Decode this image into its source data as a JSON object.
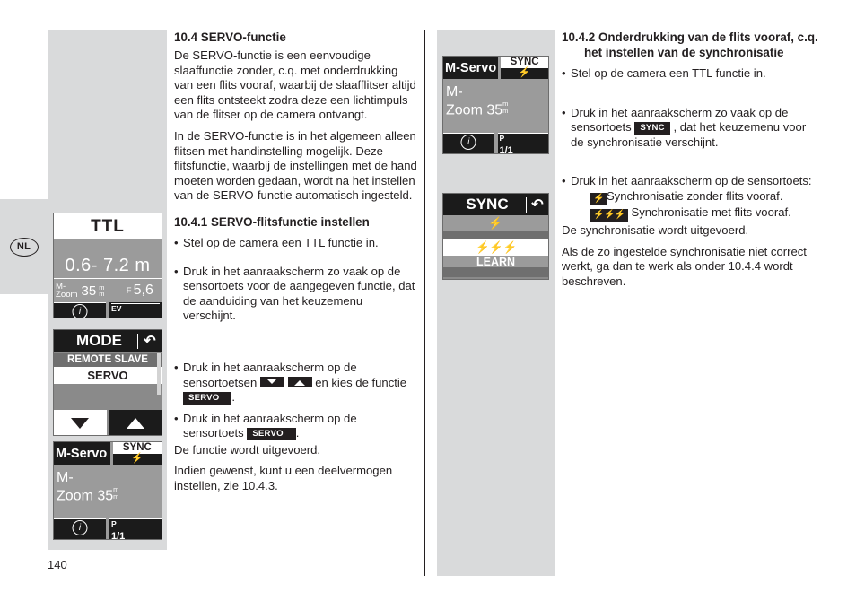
{
  "page": {
    "number": "140",
    "language_badge": "NL"
  },
  "column_left_figures": {
    "ttl_display": {
      "title": "TTL",
      "range": "0.6- 7.2 m",
      "zoom_label_line1": "M-",
      "zoom_label_line2": "Zoom",
      "zoom_value": "35",
      "zoom_unit_top": "m",
      "zoom_unit_bottom": "m",
      "aperture_prefix": "F",
      "aperture_value": "5,6",
      "info_symbol": "i",
      "ev_label": "EV"
    },
    "mode_display": {
      "title": "MODE",
      "back_icon": "↶",
      "item_1": "REMOTE SLAVE",
      "item_2_selected": "SERVO",
      "button_down": "down-arrow",
      "button_up": "up-arrow"
    },
    "mservo_display": {
      "left_label": "M-Servo",
      "sync_label": "SYNC",
      "sync_bolt": "⚡",
      "body_line1": "M-",
      "body_line2_prefix": "Zoom",
      "body_zoom_value": "35",
      "body_unit_top": "m",
      "body_unit_bottom": "m",
      "info_symbol": "i",
      "p_label": "P",
      "p_value": "1/1"
    }
  },
  "column_mid_figures": {
    "mservo_display": {
      "left_label": "M-Servo",
      "sync_label": "SYNC",
      "sync_bolt": "⚡",
      "body_line1": "M-",
      "body_line2_prefix": "Zoom",
      "body_zoom_value": "35",
      "body_unit_top": "m",
      "body_unit_bottom": "m",
      "info_symbol": "i",
      "p_label": "P",
      "p_value": "1/1"
    },
    "sync_menu_display": {
      "title": "SYNC",
      "back_icon": "↶",
      "option_1": "⚡",
      "option_2": "⚡⚡⚡",
      "option_3": "LEARN"
    }
  },
  "column_2": {
    "heading_main": "10.4 SERVO-functie",
    "para_1": "De SERVO-functie is een eenvoudige slaaffunctie zonder, c.q. met onderdrukking van een flits vooraf,  waarbij de slaafflitser altijd een flits ontsteekt zodra deze een lichtimpuls van de flitser op de camera ontvangt.",
    "para_2": "In de SERVO-functie is in het algemeen alleen flitsen met handinstelling mogelijk. Deze flitsfunctie,  waarbij de instellingen met de hand moeten worden gedaan, wordt na het instellen van de SERVO-functie automatisch ingesteld.",
    "heading_sub": "10.4.1 SERVO-flitsfunctie instellen",
    "bullet_1": "Stel op de camera een TTL functie in.",
    "bullet_2": "Druk in het aanraakscherm zo vaak op de sensortoets voor de aangegeven functie, dat de aanduiding van het keuzemenu verschijnt.",
    "bullet_3_pre": "Druk in het aanraakscherm op de sensortoetsen",
    "bullet_3_mid": "en kies de functie",
    "bullet_3_badge": "SERVO",
    "bullet_3_post": ".",
    "bullet_4_pre": "Druk in het aanraakscherm op de sensortoets",
    "bullet_4_badge": "SERVO",
    "bullet_4_post": ".",
    "para_3": "De functie wordt uitgevoerd.",
    "para_4": "Indien gewenst, kunt u een deelvermogen instellen, zie 10.4.3."
  },
  "column_3": {
    "heading_line1": "10.4.2 Onderdrukking van de flits vooraf, c.q.",
    "heading_line2": "het instellen van de synchronisatie",
    "bullet_1": "Stel op de camera een TTL functie in.",
    "bullet_2_pre": "Druk in het aanraakscherm zo vaak op de sensortoets",
    "bullet_2_badge": "SYNC",
    "bullet_2_post": ", dat het keuzemenu voor de synchronisatie verschijnt.",
    "bullet_3_pre": "Druk in het aanraakscherm op de sensortoets:",
    "bullet_3_icon1": "⚡",
    "bullet_3_text1": "Synchronisatie zonder flits vooraf.",
    "bullet_3_icon2": "⚡⚡⚡",
    "bullet_3_text2": "Synchronisatie met flits vooraf.",
    "para_1": "De synchronisatie wordt uitgevoerd.",
    "para_2": "Als de zo ingestelde synchronisatie niet correct werkt, ga dan te werk als onder 10.4.4 wordt beschreven."
  },
  "colors": {
    "figure_bg": "#d9dadb",
    "lcd_gray": "#9b9b9b",
    "lcd_dark": "#1b1b1b",
    "text": "#231f20"
  }
}
